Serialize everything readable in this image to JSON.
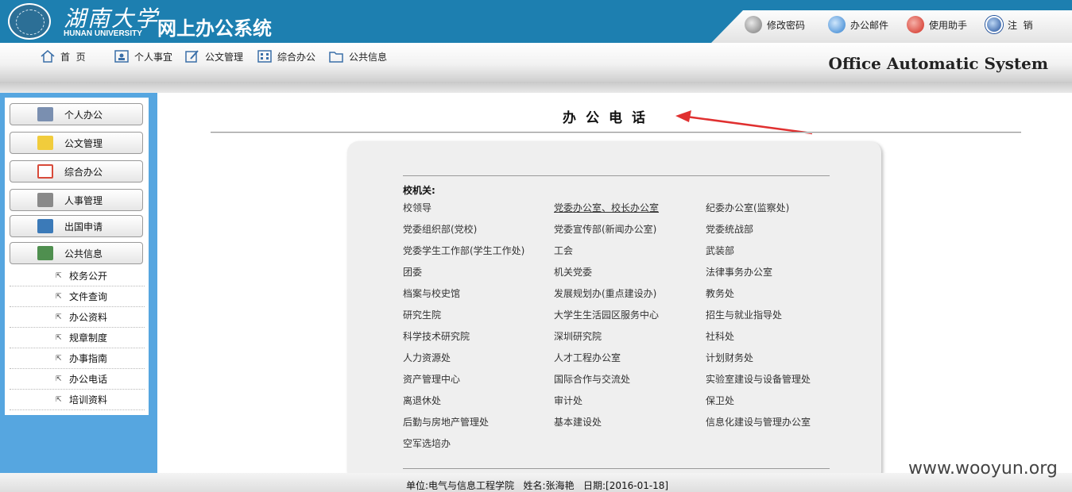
{
  "header": {
    "logo_cn": "湖南大学",
    "logo_en": "HUNAN UNIVERSITY",
    "system_title": "网上办公系统",
    "utilities": [
      {
        "label": "修改密码",
        "icon": "key-icon"
      },
      {
        "label": "办公邮件",
        "icon": "mail-icon"
      },
      {
        "label": "使用助手",
        "icon": "help-icon"
      },
      {
        "label": "注  销",
        "icon": "power-icon"
      }
    ]
  },
  "nav": {
    "items": [
      {
        "label": "首  页",
        "icon": "home-icon"
      },
      {
        "label": "个人事宜",
        "icon": "person-icon"
      },
      {
        "label": "公文管理",
        "icon": "edit-icon"
      },
      {
        "label": "综合办公",
        "icon": "grid-icon"
      },
      {
        "label": "公共信息",
        "icon": "folder-icon"
      }
    ],
    "brand": "Office Automatic System"
  },
  "sidebar": {
    "buttons": [
      {
        "label": "个人办公",
        "icon": "id-card-icon",
        "color": "#7a8fb0"
      },
      {
        "label": "公文管理",
        "icon": "note-icon",
        "color": "#f1cc3c"
      },
      {
        "label": "综合办公",
        "icon": "checklist-icon",
        "color": "#d84a3a"
      },
      {
        "label": "人事管理",
        "icon": "user-icon",
        "color": "#8a8a8a"
      },
      {
        "label": "出国申请",
        "icon": "passport-icon",
        "color": "#3b7ab8"
      },
      {
        "label": "公共信息",
        "icon": "book-icon",
        "color": "#4f8f4f"
      }
    ],
    "sub_items": [
      "校务公开",
      "文件查询",
      "办公资料",
      "规章制度",
      "办事指南",
      "办公电话",
      "培训资料"
    ]
  },
  "main": {
    "title": "办公电话",
    "section_heading": "校机关:",
    "departments": [
      [
        "校领导",
        "党委办公室、校长办公室",
        "纪委办公室(监察处)"
      ],
      [
        "党委组织部(党校)",
        "党委宣传部(新闻办公室)",
        "党委统战部"
      ],
      [
        "党委学生工作部(学生工作处)",
        "工会",
        "武装部"
      ],
      [
        "团委",
        "机关党委",
        "法律事务办公室"
      ],
      [
        "档案与校史馆",
        "发展规划办(重点建设办)",
        "教务处"
      ],
      [
        "研究生院",
        "大学生生活园区服务中心",
        "招生与就业指导处"
      ],
      [
        "科学技术研究院",
        "深圳研究院",
        "社科处"
      ],
      [
        "人力资源处",
        "人才工程办公室",
        "计划财务处"
      ],
      [
        "资产管理中心",
        "国际合作与交流处",
        "实验室建设与设备管理处"
      ],
      [
        "离退休处",
        "审计处",
        "保卫处"
      ],
      [
        "后勤与房地产管理处",
        "基本建设处",
        "信息化建设与管理办公室"
      ],
      [
        "空军选培办",
        "",
        ""
      ]
    ]
  },
  "footer": {
    "text": "单位:电气与信息工程学院   姓名:张海艳   日期:[2016-01-18]"
  },
  "watermark": "www.wooyun.org",
  "colors": {
    "header_blue": "#1d7fb0",
    "sidebar_blue": "#56a6e0",
    "arrow_red": "#e03030"
  }
}
